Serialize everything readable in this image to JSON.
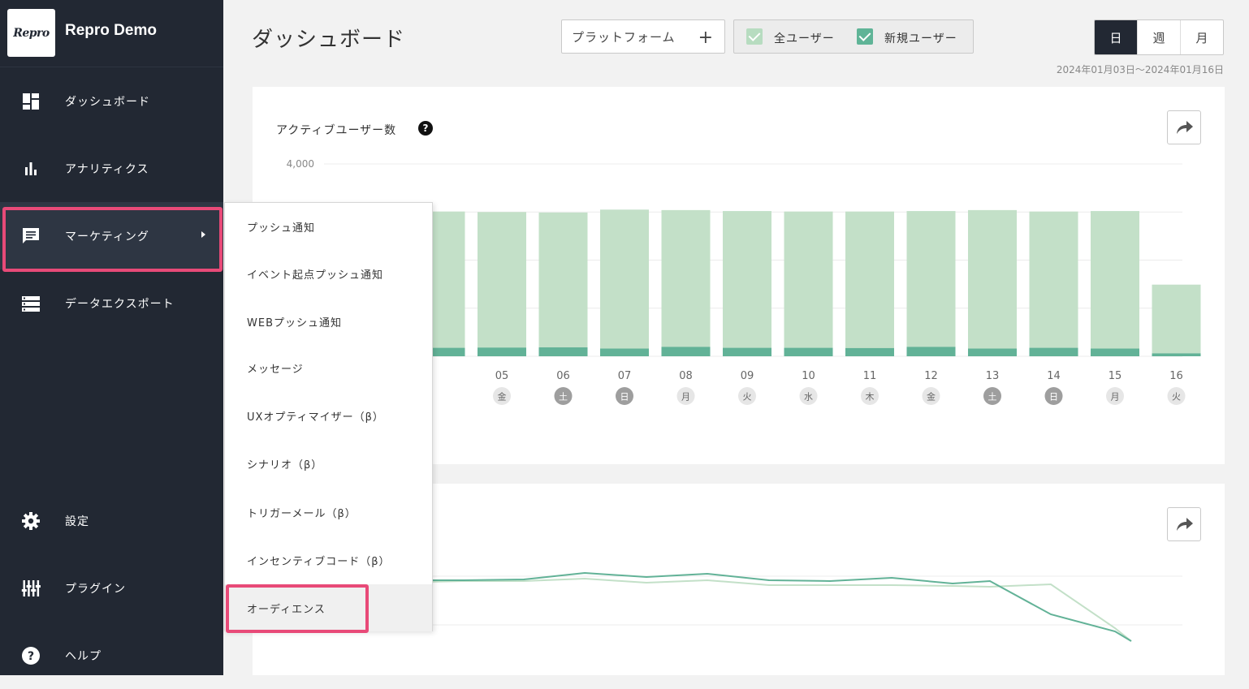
{
  "brand": {
    "logo_text": "Repro",
    "name": "Repro Demo"
  },
  "sidebar": {
    "items": [
      {
        "label": "ダッシュボード",
        "icon": "dashboard-icon"
      },
      {
        "label": "アナリティクス",
        "icon": "bar-chart-icon"
      },
      {
        "label": "マーケティング",
        "icon": "message-icon"
      },
      {
        "label": "データエクスポート",
        "icon": "list-icon"
      },
      {
        "label": "設定",
        "icon": "gear-icon"
      },
      {
        "label": "プラグイン",
        "icon": "equalizer-icon"
      },
      {
        "label": "ヘルプ",
        "icon": "help-icon"
      }
    ]
  },
  "submenu": {
    "items": [
      "プッシュ通知",
      "イベント起点プッシュ通知",
      "WEBプッシュ通知",
      "メッセージ",
      "UXオプティマイザー（β）",
      "シナリオ（β）",
      "トリガーメール（β）",
      "インセンティブコード（β）",
      "オーディエンス"
    ]
  },
  "header": {
    "title": "ダッシュボード",
    "platform_label": "プラットフォーム",
    "plus": "+",
    "filters": [
      {
        "label": "全ユーザー",
        "checked": true,
        "color": "#b7dcc0"
      },
      {
        "label": "新規ユーザー",
        "checked": true,
        "color": "#5fb497"
      }
    ],
    "period": [
      "日",
      "週",
      "月"
    ],
    "period_selected": "日",
    "date_range": "2024年01月03日〜2024年01月16日"
  },
  "active_users_card": {
    "title": "アクティブユーザー数",
    "help": "?"
  },
  "colors": {
    "all_users": "#c3e0c8",
    "new_users": "#62b297",
    "highlight": "#e84a78",
    "sidebar": "#222833"
  },
  "chart_data": [
    {
      "type": "bar",
      "title": "アクティブユーザー数",
      "ylim": [
        0,
        4000
      ],
      "y_ticks": [
        "4,000"
      ],
      "categories": [
        "05",
        "06",
        "07",
        "08",
        "09",
        "10",
        "11",
        "12",
        "13",
        "14",
        "15",
        "16"
      ],
      "weekdays": [
        "金",
        "土",
        "日",
        "月",
        "火",
        "水",
        "木",
        "金",
        "土",
        "日",
        "月",
        "火"
      ],
      "weekend_days": [
        "土",
        "日"
      ],
      "series": [
        {
          "values": [
            3000,
            2990,
            3050,
            3040,
            3020,
            3010,
            3010,
            3020,
            3040,
            3010,
            3020,
            1490
          ]
        },
        {
          "values": [
            180,
            185,
            160,
            195,
            175,
            175,
            170,
            195,
            160,
            175,
            160,
            60
          ]
        }
      ]
    },
    {
      "type": "line",
      "series": [
        {
          "values": [
            1690,
            1700,
            1700,
            1730,
            1680,
            1710,
            1650,
            1650,
            1650,
            1640,
            1630,
            1660,
            1120,
            960
          ]
        },
        {
          "values": [
            1710,
            1710,
            1720,
            1800,
            1750,
            1790,
            1710,
            1700,
            1740,
            1670,
            1700,
            1290,
            1080,
            960
          ]
        }
      ]
    }
  ]
}
